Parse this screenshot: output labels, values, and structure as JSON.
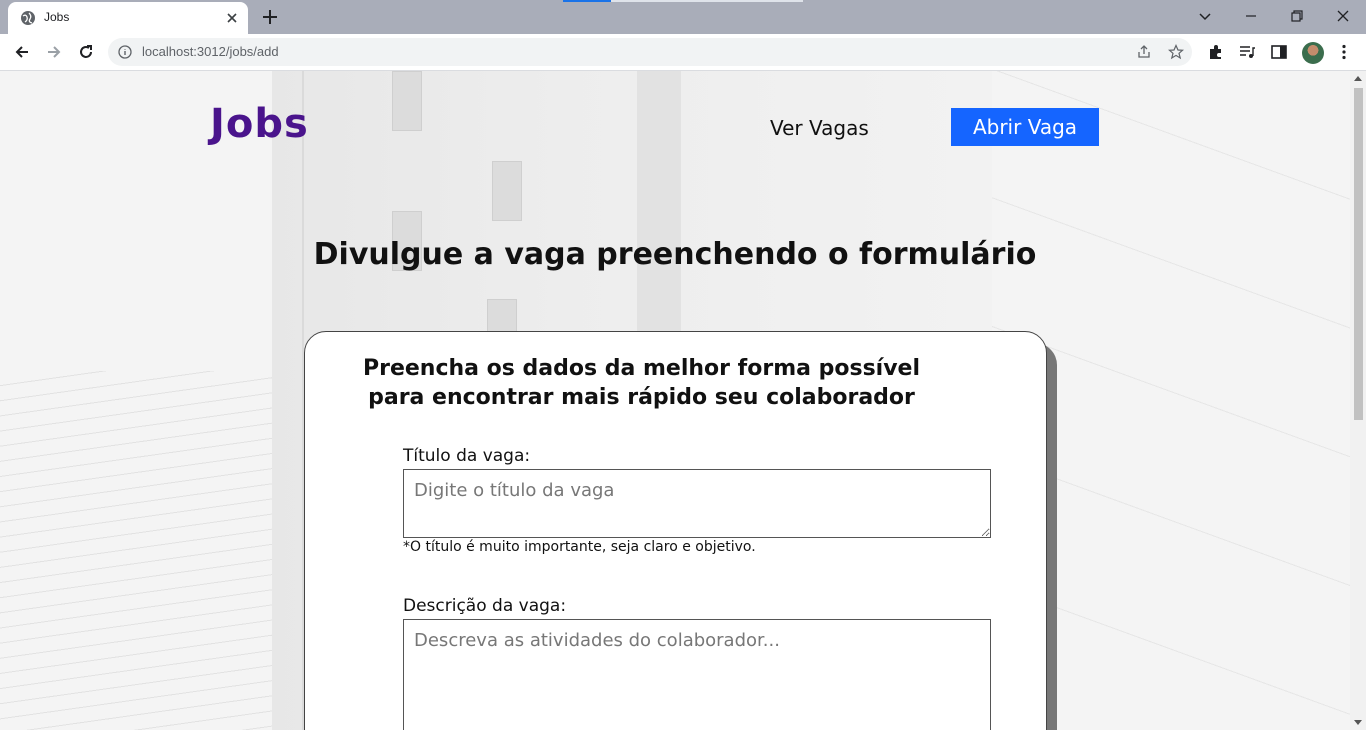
{
  "browser": {
    "tab_title": "Jobs",
    "url": "localhost:3012/jobs/add"
  },
  "header": {
    "logo": "Jobs",
    "nav_link": "Ver Vagas",
    "cta": "Abrir Vaga"
  },
  "main": {
    "headline": "Divulgue a vaga preenchendo o formulário"
  },
  "form": {
    "title_line1": "Preencha os dados da melhor forma possível",
    "title_line2": "para encontrar mais rápido seu colaborador",
    "title_label": "Título da vaga:",
    "title_placeholder": "Digite o título da vaga",
    "title_hint": "*O título é muito importante, seja claro e objetivo.",
    "description_label": "Descrição da vaga:",
    "description_placeholder": "Descreva as atividades do colaborador..."
  },
  "colors": {
    "logo": "#4a148c",
    "cta_background": "#1565ff",
    "tabstrip": "#a9adb9"
  }
}
